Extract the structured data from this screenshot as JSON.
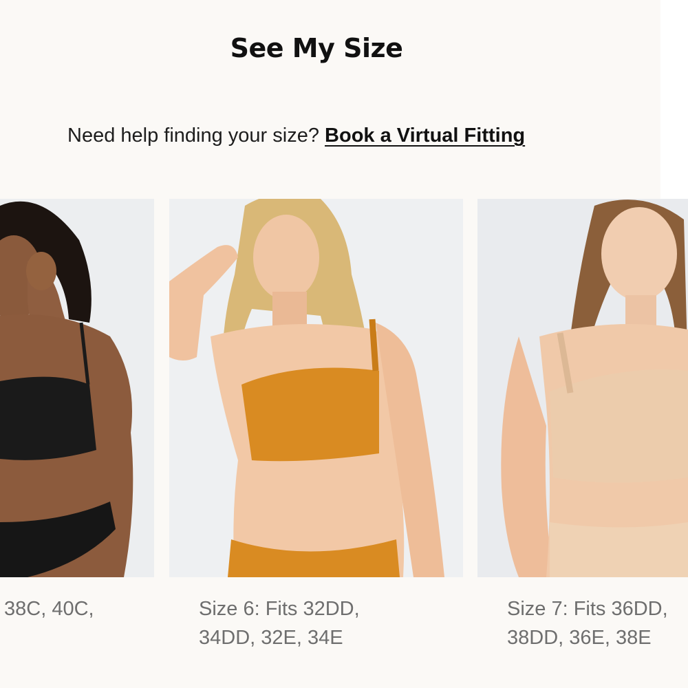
{
  "header": {
    "title": "See My Size",
    "help_text": "Need help finding your size?",
    "link_text": "Book a Virtual Fitting"
  },
  "products": [
    {
      "image_alt": "Model wearing black bra and black underwear",
      "bra_color": "#1a1a1a",
      "caption_lines": [
        "38C, 40C,"
      ]
    },
    {
      "image_alt": "Model wearing orange bra and orange underwear",
      "bra_color": "#d98b22",
      "caption_lines": [
        "Size 6: Fits 32DD,",
        "34DD, 32E, 34E"
      ]
    },
    {
      "image_alt": "Model wearing nude bra and nude underwear",
      "bra_color": "#ecccac",
      "caption_lines": [
        "Size 7: Fits 36DD,",
        "38DD, 36E, 38E"
      ]
    }
  ],
  "colors": {
    "page_background": "#fbf9f6",
    "caption_text": "#6e6e6e",
    "heading_text": "#111111"
  }
}
